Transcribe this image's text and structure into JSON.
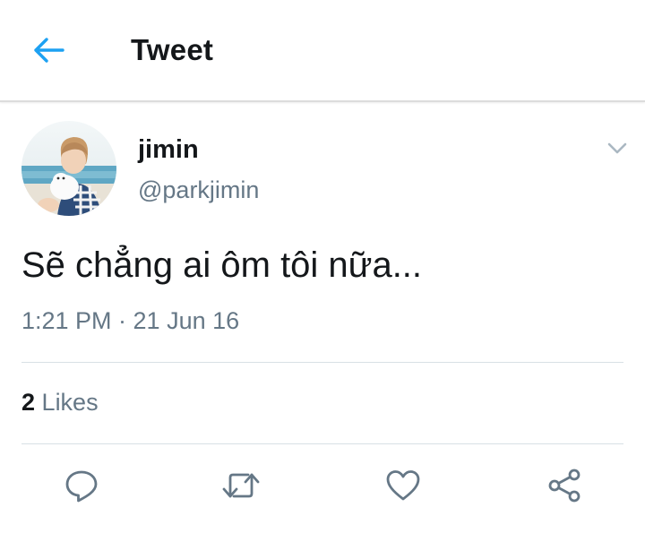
{
  "header": {
    "title": "Tweet",
    "back_icon": "arrow-left-icon",
    "back_color": "#1da1f2"
  },
  "tweet": {
    "display_name": "jimin",
    "handle": "@parkjimin",
    "text": "Sẽ chẳng ai ôm tôi nữa...",
    "timestamp": "1:21 PM · 21 Jun 16",
    "likes_count": "2",
    "likes_label": "Likes",
    "menu_icon": "chevron-down-icon"
  },
  "actions": [
    {
      "name": "reply",
      "icon": "reply-icon"
    },
    {
      "name": "retweet",
      "icon": "retweet-icon"
    },
    {
      "name": "like",
      "icon": "heart-icon"
    },
    {
      "name": "share",
      "icon": "share-icon"
    }
  ],
  "colors": {
    "text_primary": "#14171a",
    "text_secondary": "#657786",
    "accent": "#1da1f2",
    "divider": "#d8e0e5"
  }
}
